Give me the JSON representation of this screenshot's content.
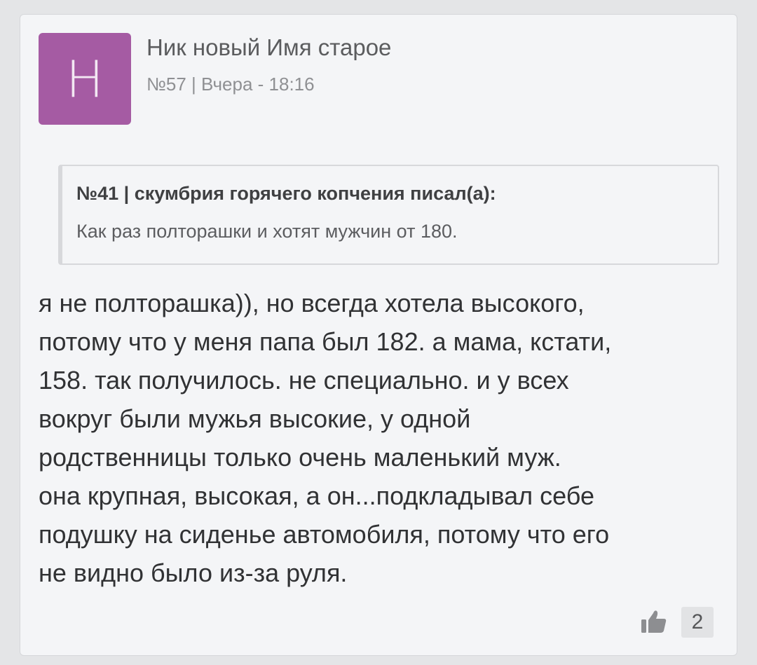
{
  "post": {
    "avatar_letter": "Н",
    "avatar_color": "#a55ba3",
    "author": "Ник новый Имя старое",
    "meta": "№57 | Вчера - 18:16",
    "quote": {
      "title": "№41 | скумбрия горячего копчения писал(а):",
      "text": "Как раз полторашки и хотят мужчин от 180."
    },
    "body": "я не полторашка)), но всегда хотела высокого,\nпотому что у меня папа был 182. а мама, кстати,\n158. так получилось. не специально. и у всех\nвокруг были мужья высокие, у одной\nродственницы только очень маленький муж.\nона крупная, высокая, а он...подкладывал себе\nподушку на сиденье автомобиля, потому что его\nне видно было из-за руля.",
    "like_icon": "thumbs-up-icon",
    "likes": "2"
  }
}
